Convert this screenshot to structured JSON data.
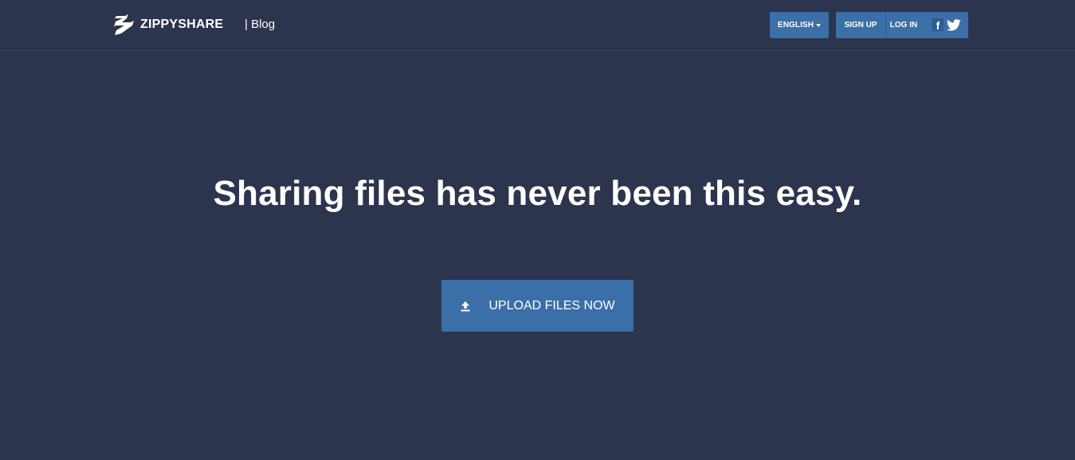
{
  "header": {
    "logo_text": "ZIPPYSHARE",
    "blog_link": "| Blog",
    "language_button": "ENGLISH",
    "signup_button": "SIGN UP",
    "login_button": "LOG IN",
    "facebook_glyph": "f"
  },
  "hero": {
    "title": "Sharing files has never been this easy.",
    "upload_button": "UPLOAD FILES NOW"
  },
  "icons": {
    "logo": "zippyshare-logo-icon",
    "language_dropdown": "caret-down-icon",
    "facebook": "facebook-icon",
    "twitter": "twitter-icon",
    "upload": "upload-icon"
  },
  "colors": {
    "background": "#2d344e",
    "button": "#3a6fa8",
    "text": "#ffffff"
  }
}
